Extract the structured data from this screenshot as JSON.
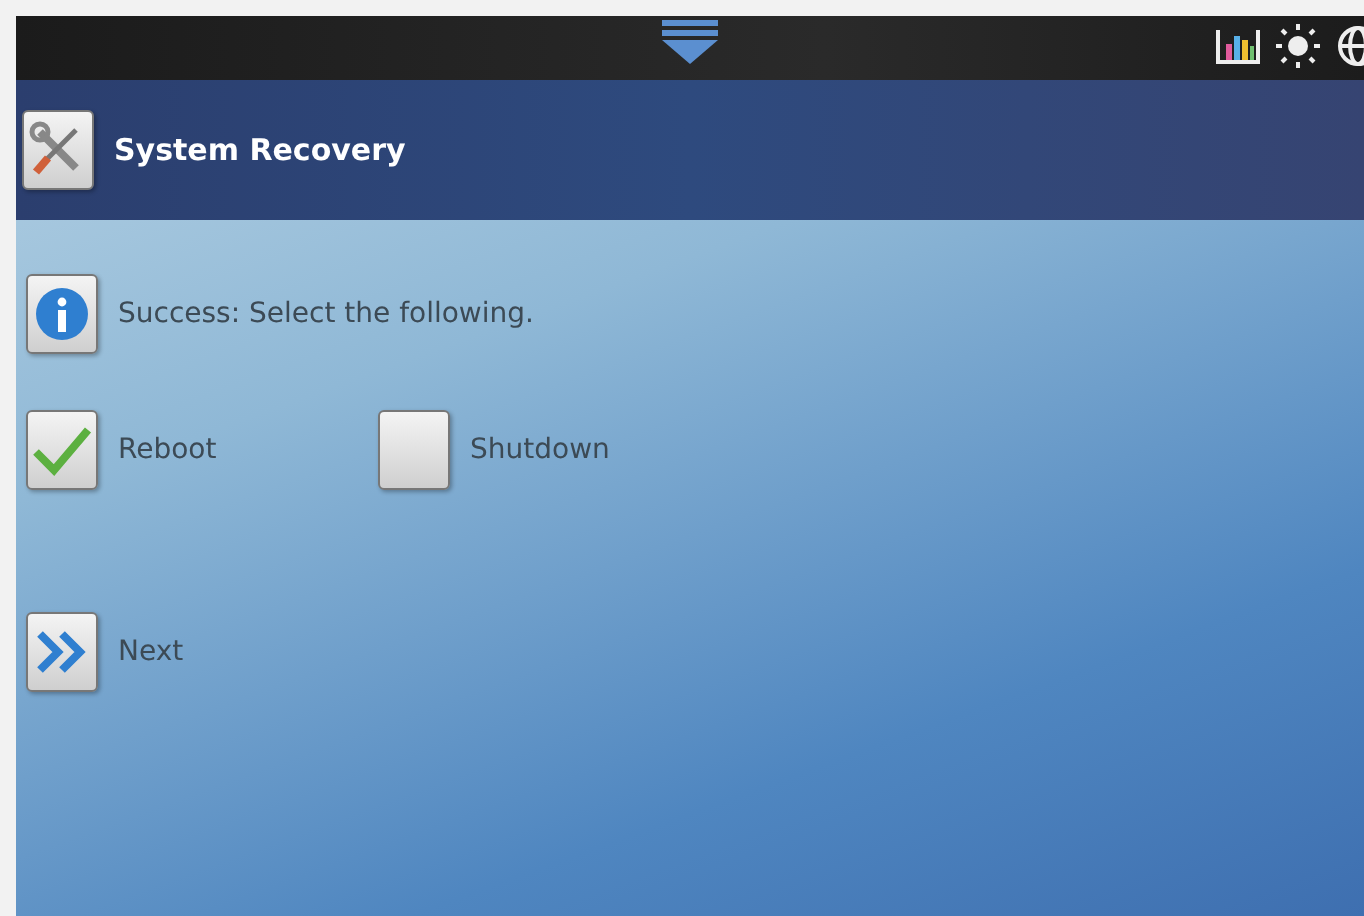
{
  "header": {
    "title": "System Recovery"
  },
  "message": "Success: Select the following.",
  "options": [
    {
      "label": "Reboot",
      "selected": true
    },
    {
      "label": "Shutdown",
      "selected": false
    }
  ],
  "next_button": {
    "label": "Next"
  }
}
